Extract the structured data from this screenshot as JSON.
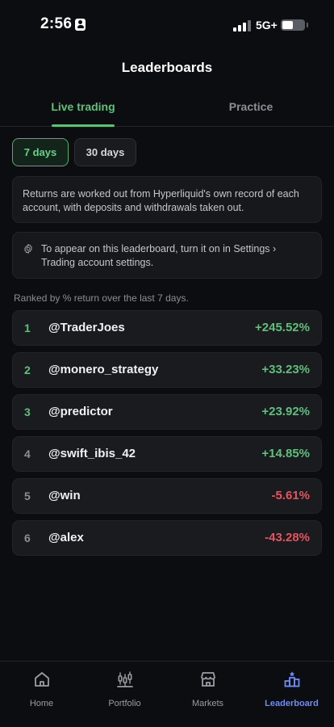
{
  "status_bar": {
    "time": "2:56",
    "network": "5G+"
  },
  "header": {
    "title": "Leaderboards"
  },
  "tabs": [
    {
      "label": "Live trading",
      "active": true
    },
    {
      "label": "Practice",
      "active": false
    }
  ],
  "periods": [
    {
      "label": "7 days",
      "selected": true
    },
    {
      "label": "30 days",
      "selected": false
    }
  ],
  "info": {
    "returns_note": "Returns are worked out from Hyperliquid's own record of each account, with deposits and withdrawals taken out.",
    "settings_note": "To appear on this leaderboard, turn it on in Settings › Trading account settings.",
    "settings_icon": "gear-icon"
  },
  "ranked_caption": "Ranked by % return over the last 7 days.",
  "leaderboard": [
    {
      "rank": "1",
      "handle": "@TraderJoes",
      "return": "+245.52%"
    },
    {
      "rank": "2",
      "handle": "@monero_strategy",
      "return": "+33.23%"
    },
    {
      "rank": "3",
      "handle": "@predictor",
      "return": "+23.92%"
    },
    {
      "rank": "4",
      "handle": "@swift_ibis_42",
      "return": "+14.85%"
    },
    {
      "rank": "5",
      "handle": "@win",
      "return": "-5.61%"
    },
    {
      "rank": "6",
      "handle": "@alex",
      "return": "-43.28%"
    }
  ],
  "nav": [
    {
      "label": "Home",
      "icon": "home-icon",
      "active": false
    },
    {
      "label": "Portfolio",
      "icon": "portfolio-icon",
      "active": false
    },
    {
      "label": "Markets",
      "icon": "markets-icon",
      "active": false
    },
    {
      "label": "Leaderboard",
      "icon": "leaderboard-icon",
      "active": true
    }
  ],
  "colors": {
    "background": "#0c0d10",
    "accent_green": "#5ec07a",
    "negative_red": "#e5535d",
    "nav_active_blue": "#6d8cf5"
  }
}
